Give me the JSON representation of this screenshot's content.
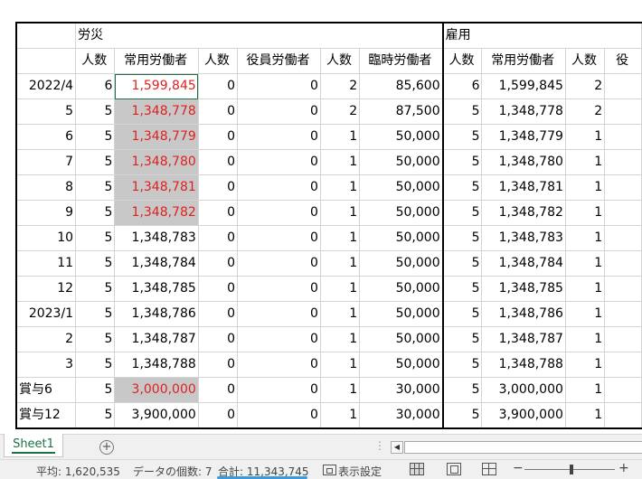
{
  "sheet": {
    "group_headers": {
      "rousai": "労災",
      "koyou": "雇用"
    },
    "column_headers": [
      "人数",
      "常用労働者",
      "人数",
      "役員労働者",
      "人数",
      "臨時労働者",
      "人数",
      "常用労働者",
      "人数",
      "役"
    ],
    "rows": [
      {
        "label": "2022/4",
        "c": [
          "6",
          "1,599,845",
          "0",
          "0",
          "2",
          "85,600",
          "6",
          "1,599,845",
          "2"
        ]
      },
      {
        "label": "5",
        "c": [
          "5",
          "1,348,778",
          "0",
          "0",
          "2",
          "87,500",
          "5",
          "1,348,778",
          "2"
        ]
      },
      {
        "label": "6",
        "c": [
          "5",
          "1,348,779",
          "0",
          "0",
          "1",
          "50,000",
          "5",
          "1,348,779",
          "1"
        ]
      },
      {
        "label": "7",
        "c": [
          "5",
          "1,348,780",
          "0",
          "0",
          "1",
          "50,000",
          "5",
          "1,348,780",
          "1"
        ]
      },
      {
        "label": "8",
        "c": [
          "5",
          "1,348,781",
          "0",
          "0",
          "1",
          "50,000",
          "5",
          "1,348,781",
          "1"
        ]
      },
      {
        "label": "9",
        "c": [
          "5",
          "1,348,782",
          "0",
          "0",
          "1",
          "50,000",
          "5",
          "1,348,782",
          "1"
        ]
      },
      {
        "label": "10",
        "c": [
          "5",
          "1,348,783",
          "0",
          "0",
          "1",
          "50,000",
          "5",
          "1,348,783",
          "1"
        ]
      },
      {
        "label": "11",
        "c": [
          "5",
          "1,348,784",
          "0",
          "0",
          "1",
          "50,000",
          "5",
          "1,348,784",
          "1"
        ]
      },
      {
        "label": "12",
        "c": [
          "5",
          "1,348,785",
          "0",
          "0",
          "1",
          "50,000",
          "5",
          "1,348,785",
          "1"
        ]
      },
      {
        "label": "2023/1",
        "c": [
          "5",
          "1,348,786",
          "0",
          "0",
          "1",
          "50,000",
          "5",
          "1,348,786",
          "1"
        ]
      },
      {
        "label": "2",
        "c": [
          "5",
          "1,348,787",
          "0",
          "0",
          "1",
          "50,000",
          "5",
          "1,348,787",
          "1"
        ]
      },
      {
        "label": "3",
        "c": [
          "5",
          "1,348,788",
          "0",
          "0",
          "1",
          "50,000",
          "5",
          "1,348,788",
          "1"
        ]
      },
      {
        "label": "賞与6",
        "c": [
          "5",
          "3,000,000",
          "0",
          "0",
          "1",
          "30,000",
          "5",
          "3,000,000",
          "1"
        ]
      },
      {
        "label": "賞与12",
        "c": [
          "5",
          "3,900,000",
          "0",
          "0",
          "1",
          "30,000",
          "5",
          "3,900,000",
          "1"
        ]
      }
    ],
    "highlight_color": "#c8c8c8",
    "red_text_color": "#e02020"
  },
  "tabs": {
    "sheet1": "Sheet1",
    "add_icon": "plus-circle-icon"
  },
  "status": {
    "average": "平均: 1,620,535",
    "count": "データの個数: 7",
    "sum": "合計: 11,343,745",
    "display_settings": "表示設定",
    "zoom_minus": "−",
    "zoom_plus": "+"
  }
}
